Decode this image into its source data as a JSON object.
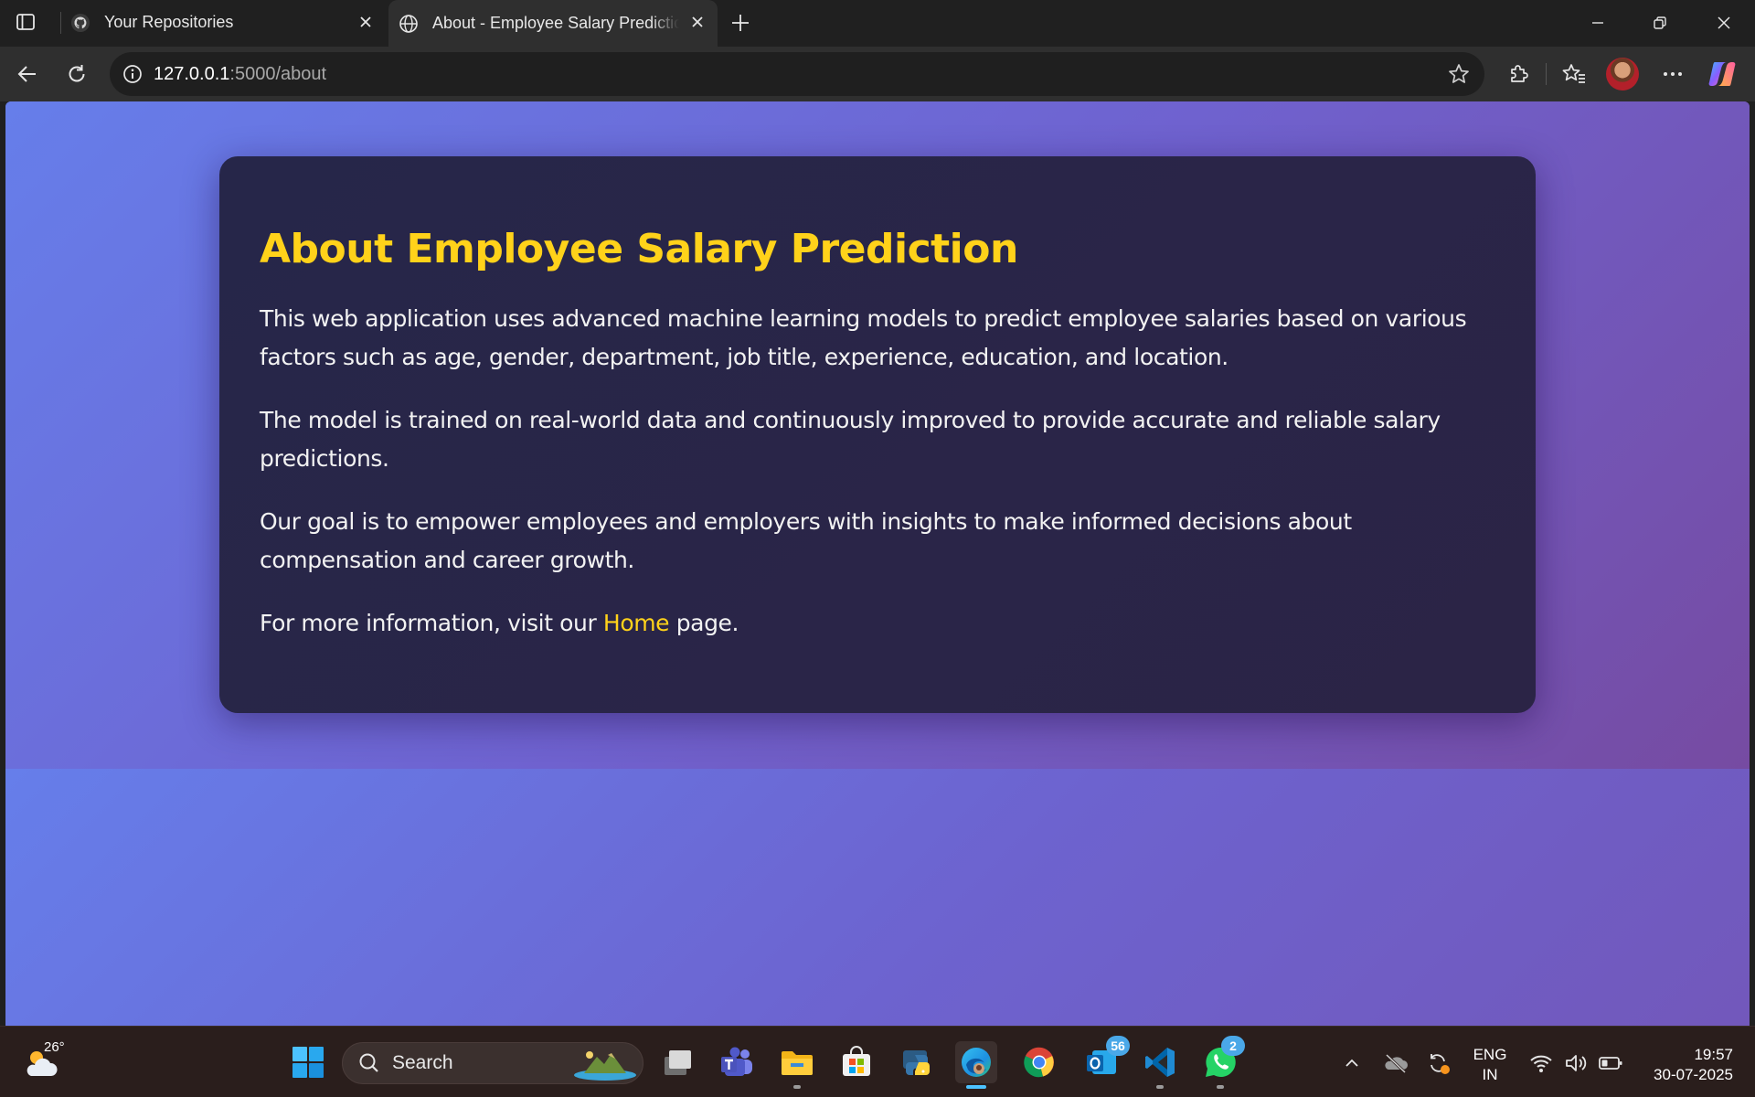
{
  "browser": {
    "tabs": [
      {
        "title": "Your Repositories",
        "icon": "github-icon",
        "active": false
      },
      {
        "title": "About - Employee Salary Prediction",
        "icon": "globe-icon",
        "active": true
      }
    ],
    "address": {
      "host": "127.0.0.1",
      "path": ":5000/about"
    }
  },
  "page": {
    "heading": "About Employee Salary Prediction",
    "paragraphs": [
      "This web application uses advanced machine learning models to predict employee salaries based on various factors such as age, gender, department, job title, experience, education, and location.",
      "The model is trained on real-world data and continuously improved to provide accurate and reliable salary predictions.",
      "Our goal is to empower employees and employers with insights to make informed decisions about compensation and career growth."
    ],
    "footer": {
      "prefix": "For more information, visit our ",
      "link_text": "Home",
      "suffix": " page."
    },
    "colors": {
      "accent": "#ffd21a",
      "gradient_start": "#667eea",
      "gradient_end": "#764ba2",
      "card": "#262649"
    }
  },
  "taskbar": {
    "weather_temp": "26°",
    "search_label": "Search",
    "mail_badge": "56",
    "whatsapp_badge": "2",
    "lang_line1": "ENG",
    "lang_line2": "IN",
    "time": "19:57",
    "date": "30-07-2025"
  }
}
